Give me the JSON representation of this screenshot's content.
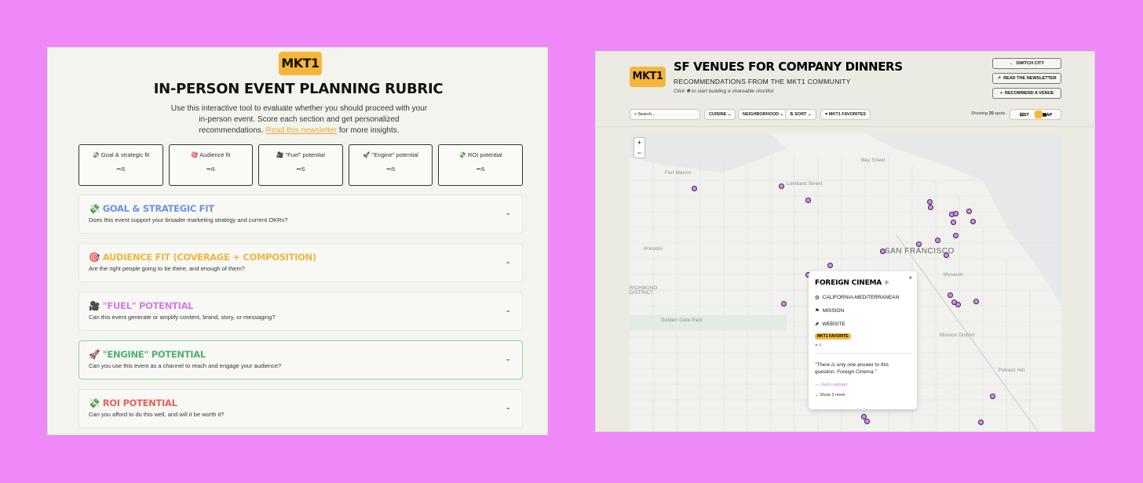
{
  "rubric": {
    "logo": "MKT1",
    "title": "IN-PERSON EVENT PLANNING RUBRIC",
    "intro": "Use this interactive tool to evaluate whether you should proceed with your in-person event. Score each section and get personalized recommendations.",
    "intro_link": "Read this newsletter",
    "intro_suffix": "for more insights.",
    "scores": [
      {
        "icon": "💸",
        "label": "Goal & strategic fit",
        "value": "–",
        "of": "/5"
      },
      {
        "icon": "🎯",
        "label": "Audience fit",
        "value": "–",
        "of": "/5"
      },
      {
        "icon": "🎥",
        "label": "\"Fuel\" potential",
        "value": "–",
        "of": "/5"
      },
      {
        "icon": "🚀",
        "label": "\"Engine\" potential",
        "value": "–",
        "of": "/5"
      },
      {
        "icon": "💸",
        "label": "ROI potential",
        "value": "–",
        "of": "/5"
      }
    ],
    "sections": [
      {
        "icon": "💸",
        "title": "GOAL & STRATEGIC FIT",
        "desc": "Does this event support your broader marketing strategy and current OKRs?",
        "color": "#6b93e0"
      },
      {
        "icon": "🎯",
        "title": "AUDIENCE FIT (COVERAGE + COMPOSITION)",
        "desc": "Are the right people going to be there, and enough of them?",
        "color": "#f0b43d"
      },
      {
        "icon": "🎥",
        "title": "\"FUEL\" POTENTIAL",
        "desc": "Can this event generate or amplify content, brand, story, or messaging?",
        "color": "#d57ae6"
      },
      {
        "icon": "🚀",
        "title": "\"ENGINE\" POTENTIAL",
        "desc": "Can you use this event as a channel to reach and engage your audience?",
        "color": "#4fb36f"
      },
      {
        "icon": "💸",
        "title": "ROI POTENTIAL",
        "desc": "Can you afford to do this well, and will it be worth it?",
        "color": "#e0645a"
      }
    ]
  },
  "venues": {
    "logo": "MKT1",
    "title": "SF VENUES FOR COMPANY DINNERS",
    "subtitle": "RECOMMENDATIONS FROM THE MKT1 COMMUNITY",
    "hint": "Click ✱ to start building a shareable shortlist",
    "buttons": [
      {
        "icon": "←",
        "label": "SWITCH CITY"
      },
      {
        "icon": "↗",
        "label": "READ THE NEWSLETTER"
      },
      {
        "icon": "+",
        "label": "RECOMMEND A VENUE"
      }
    ],
    "search_placeholder": "Search...",
    "filters": [
      "CUISINE",
      "NEIGHBORHOOD",
      "SORT",
      "MKT1 FAVORITES"
    ],
    "showing_prefix": "Showing",
    "showing_count": "35",
    "showing_suffix": "spots",
    "view_list": "LIST",
    "view_map": "MAP",
    "map_labels": {
      "city": "SAN FRANCISCO",
      "richmond": "RICHMOND DISTRICT",
      "small": [
        "Fort Mason",
        "Lombard Street",
        "Bay Street",
        "Presidio",
        "Golden Gate Park",
        "Mission District",
        "Museum",
        "Potrero Hill"
      ]
    },
    "popup": {
      "name": "FOREIGN CINEMA",
      "cuisine": "CALIFORNIA-MEDITERRANEAN",
      "neighborhood": "MISSION",
      "website": "WEBSITE",
      "badge": "MKT1 FAVORITE",
      "likes": "4",
      "quote": "\"There is only one answer to this question. Foreign Cinema.\"",
      "author": "— Josh Lowman",
      "more": "Show 3 more"
    }
  }
}
